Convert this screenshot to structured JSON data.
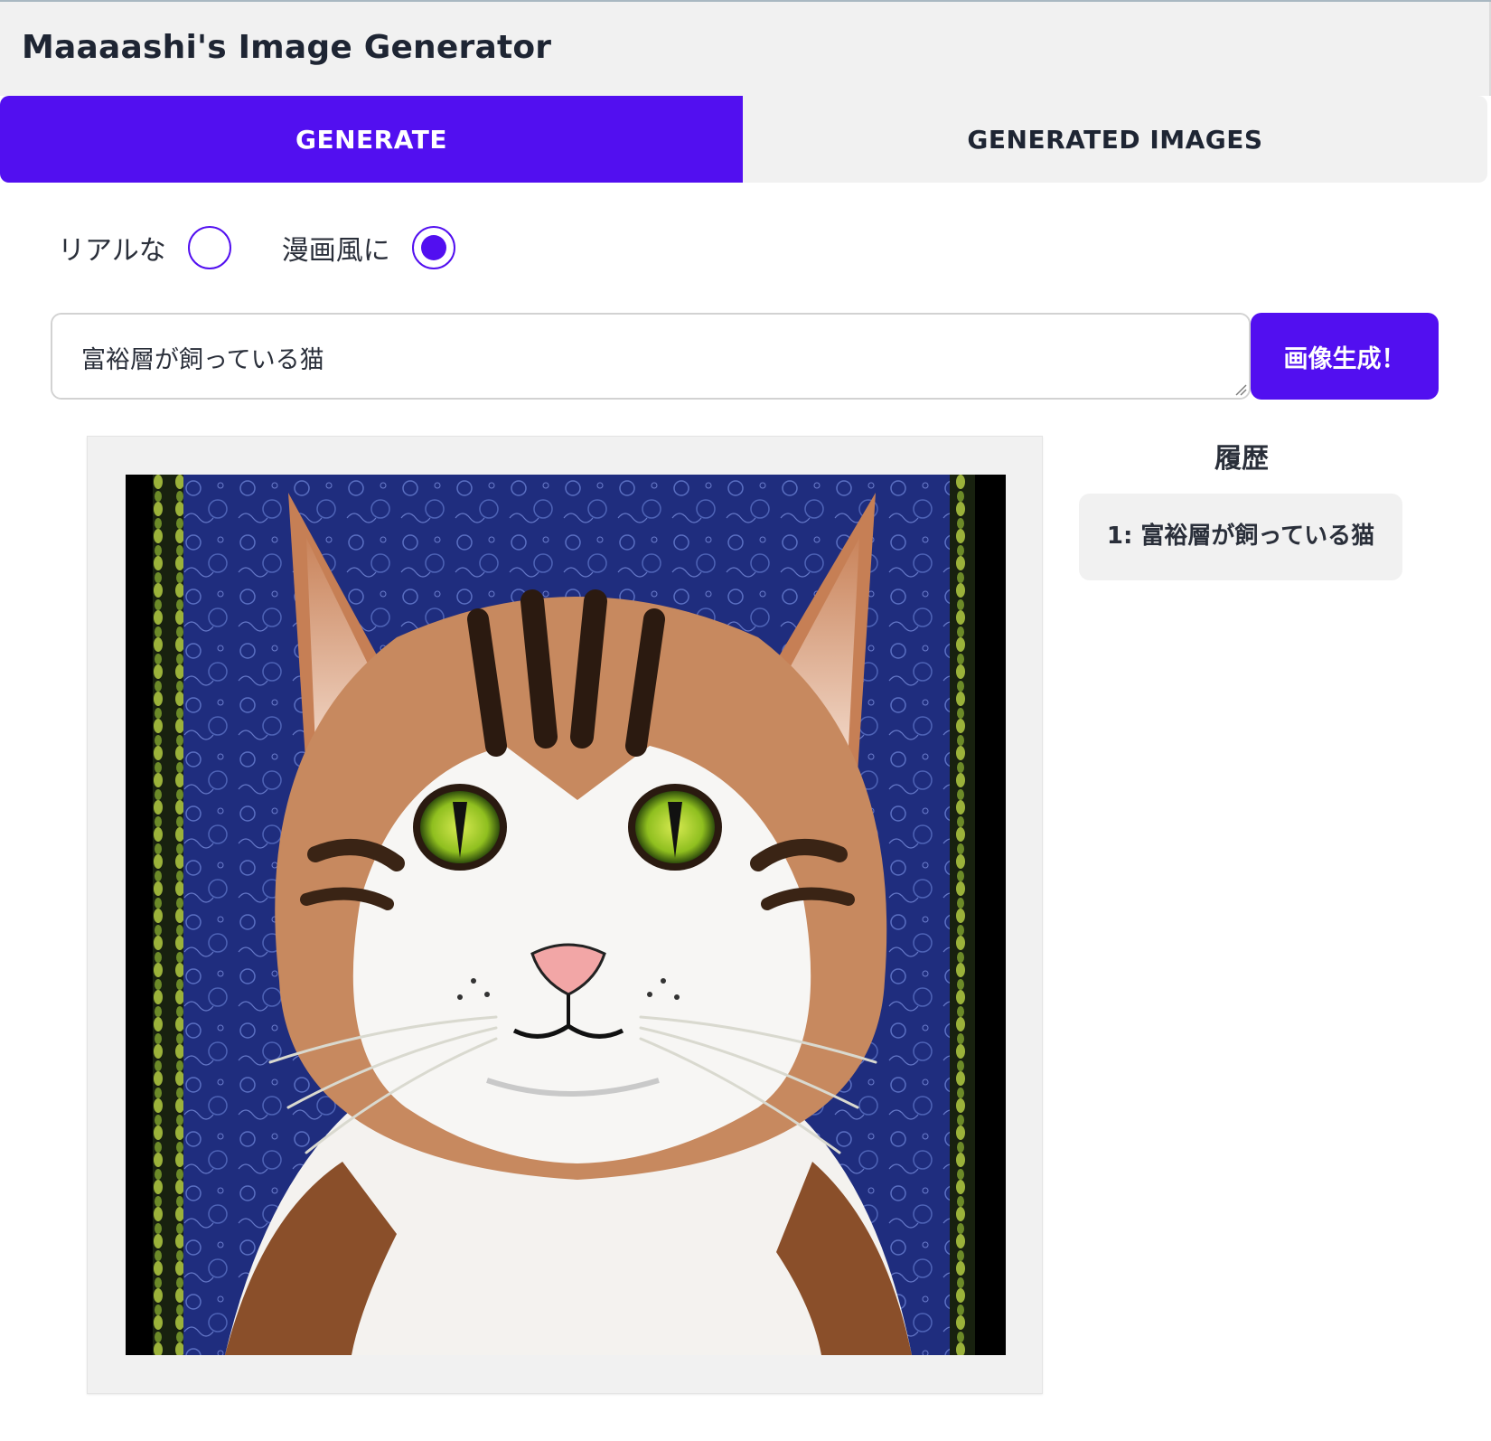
{
  "app": {
    "title": "Maaaashi's Image Generator"
  },
  "tabs": [
    {
      "label": "GENERATE",
      "active": true
    },
    {
      "label": "GENERATED IMAGES",
      "active": false
    }
  ],
  "style_options": [
    {
      "label": "リアルな",
      "selected": false
    },
    {
      "label": "漫画風に",
      "selected": true
    }
  ],
  "prompt": {
    "value": "富裕層が飼っている猫"
  },
  "generate_button": {
    "label": "画像生成！"
  },
  "history": {
    "title": "履歴",
    "items": [
      {
        "label": "1: 富裕層が飼っている猫"
      }
    ]
  },
  "colors": {
    "accent": "#520ff0",
    "header_bg": "#f1f1f1",
    "text": "#1e2533"
  }
}
